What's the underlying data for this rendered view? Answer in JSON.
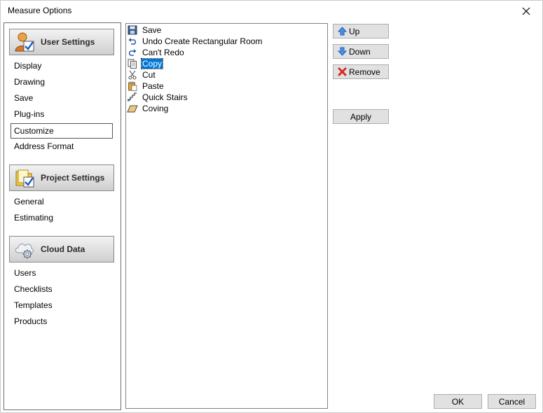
{
  "window": {
    "title": "Measure Options"
  },
  "nav": {
    "sections": [
      {
        "label": "User Settings",
        "icon": "user-check-icon",
        "items": [
          "Display",
          "Drawing",
          "Save",
          "Plug-ins",
          "Customize",
          "Address Format"
        ]
      },
      {
        "label": "Project Settings",
        "icon": "folder-check-icon",
        "items": [
          "General",
          "Estimating"
        ]
      },
      {
        "label": "Cloud Data",
        "icon": "cloud-gear-icon",
        "items": [
          "Users",
          "Checklists",
          "Templates",
          "Products"
        ]
      }
    ],
    "selected_item": "Customize"
  },
  "commands": [
    {
      "label": "Save",
      "icon": "floppy-disk-icon"
    },
    {
      "label": "Undo Create Rectangular Room",
      "icon": "undo-icon"
    },
    {
      "label": "Can't Redo",
      "icon": "redo-icon"
    },
    {
      "label": "Copy",
      "icon": "copy-icon",
      "selected": true
    },
    {
      "label": "Cut",
      "icon": "scissors-icon"
    },
    {
      "label": "Paste",
      "icon": "paste-icon"
    },
    {
      "label": "Quick Stairs",
      "icon": "stairs-icon"
    },
    {
      "label": "Coving",
      "icon": "coving-icon"
    }
  ],
  "buttons": {
    "up": "Up",
    "down": "Down",
    "remove": "Remove",
    "apply": "Apply",
    "ok": "OK",
    "cancel": "Cancel"
  },
  "colors": {
    "selection": "#0078d7",
    "button_face": "#e1e1e1",
    "arrow_blue": "#2f6fc9",
    "remove_red": "#d62b1f"
  }
}
